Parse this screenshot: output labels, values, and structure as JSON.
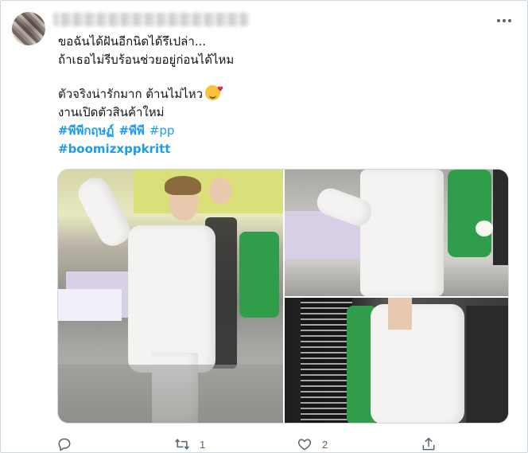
{
  "tweet": {
    "lines": [
      "ขอฉันได้ฝันอีกนิดได้รึเปล่า...",
      "ถ้าเธอไม่รีบร้อนช่วยอยู่ก่อนได้ไหม",
      "ตัวจริงน่ารักมาก  ต้านไม่ไหว",
      "งานเปิดตัวสินค้าใหม่"
    ],
    "emoji_name": "smiling-face-with-hearts",
    "hashtags_row1": [
      "#พีพีกฤษฏ์",
      "#พีพี",
      "#pp"
    ],
    "hashtags_row2": [
      "#boomizxppkritt"
    ]
  },
  "actions": {
    "reply_count": "",
    "retweet_count": "1",
    "like_count": "2",
    "share_count": ""
  },
  "colors": {
    "hashtag": "#1d9bf0",
    "icon": "#536471",
    "text": "#0f1419",
    "border": "#cfd9de"
  },
  "icons": [
    "more-icon",
    "reply-icon",
    "retweet-icon",
    "like-icon",
    "share-icon"
  ]
}
